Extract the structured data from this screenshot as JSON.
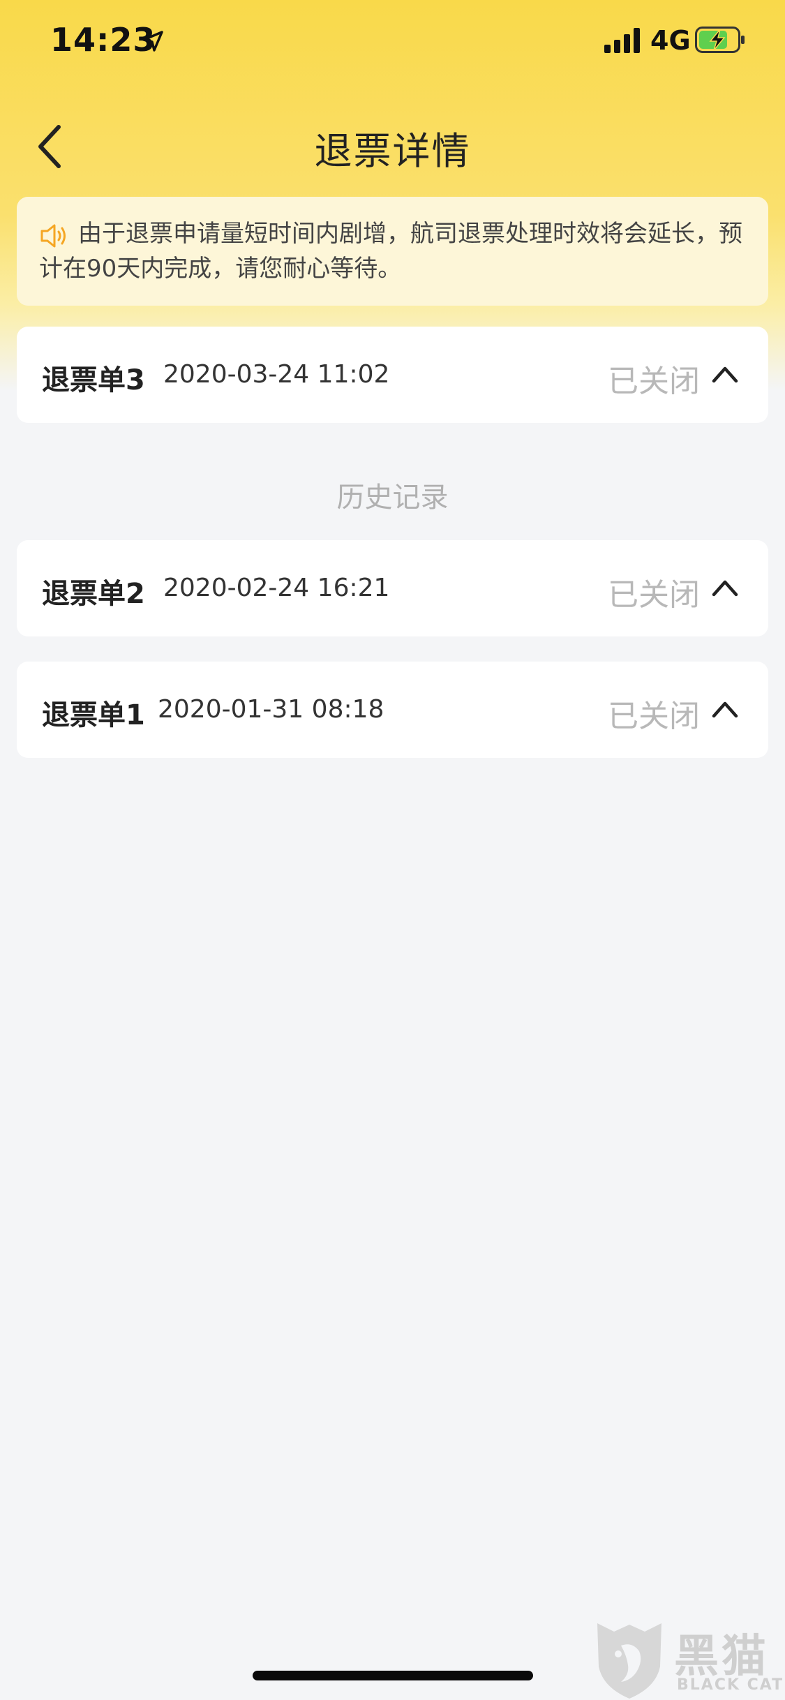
{
  "status_bar": {
    "time": "14:23",
    "network": "4G",
    "location_icon": "location-arrow-icon",
    "signal_icon": "cellular-signal-icon",
    "battery_icon": "battery-charging-icon"
  },
  "nav": {
    "title": "退票详情",
    "back_icon": "chevron-left-icon"
  },
  "notice": {
    "icon": "speaker-icon",
    "text": "由于退票申请量短时间内剧增，航司退票处理时效将会延长，预计在90天内完成，请您耐心等待。",
    "accent_color": "#f5a623"
  },
  "current_orders": [
    {
      "title": "退票单3",
      "date": "2020-03-24 11:02",
      "status": "已关闭"
    }
  ],
  "history": {
    "label": "历史记录",
    "orders": [
      {
        "title": "退票单2",
        "date": "2020-02-24 16:21",
        "status": "已关闭"
      },
      {
        "title": "退票单1",
        "date": "2020-01-31 08:18",
        "status": "已关闭"
      }
    ]
  },
  "watermark": {
    "name_cn": "黑猫",
    "name_en": "BLACK CAT",
    "logo_icon": "black-cat-shield-icon"
  },
  "colors": {
    "header_yellow": "#f9d94a",
    "background": "#f4f5f7",
    "status_gray": "#b8b8b8"
  }
}
